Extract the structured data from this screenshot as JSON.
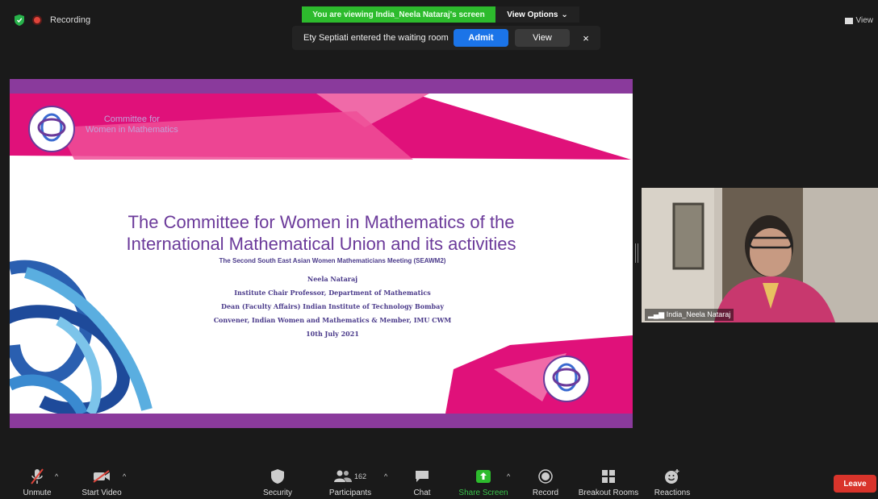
{
  "topbar": {
    "recording_label": "Recording",
    "viewing_banner": "You are viewing India_Neela Nataraj's screen",
    "view_options_label": "View Options",
    "view_label": "View"
  },
  "waiting_room": {
    "message": "Ety Septiati entered the waiting room",
    "admit_label": "Admit",
    "view_label": "View",
    "close_glyph": "×"
  },
  "slide": {
    "cwm_line1": "Committee for",
    "cwm_line2": "Women in Mathematics",
    "title_line1": "The Committee for Women in Mathematics of the",
    "title_line2": "International Mathematical Union and its activities",
    "subtitle": "The Second South East Asian Women Mathematicians Meeting (SEAWM2)",
    "lines": [
      "Neela Nataraj",
      "Institute Chair Professor, Department of Mathematics",
      "Dean (Faculty Affairs) Indian Institute of Technology Bombay",
      "Convener, Indian Women and Mathematics & Member, IMU CWM",
      "10th July 2021"
    ]
  },
  "video": {
    "participant_name": "India_Neela Nataraj"
  },
  "toolbar": {
    "unmute_label": "Unmute",
    "start_video_label": "Start Video",
    "security_label": "Security",
    "participants_label": "Participants",
    "participants_count": "162",
    "chat_label": "Chat",
    "share_screen_label": "Share Screen",
    "record_label": "Record",
    "breakout_label": "Breakout Rooms",
    "reactions_label": "Reactions",
    "leave_label": "Leave"
  },
  "colors": {
    "share_green": "#2dbb2d",
    "admit_blue": "#1b74e8",
    "leave_red": "#d9342b",
    "slide_purple": "#8a3a9c",
    "slide_pink": "#e0117a"
  }
}
